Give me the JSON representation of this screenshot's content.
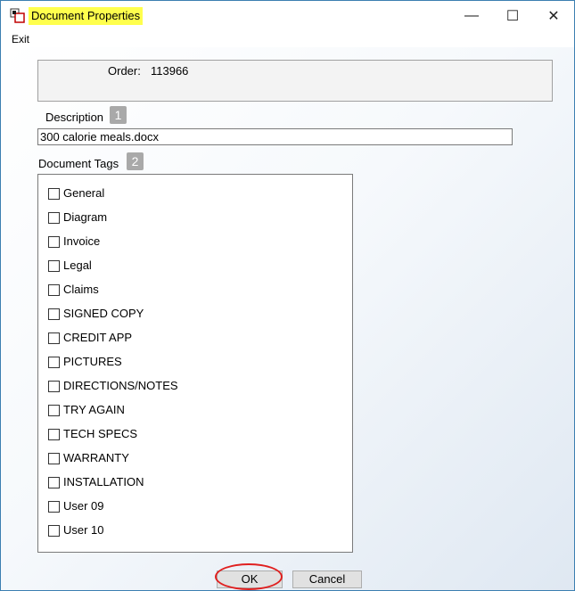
{
  "window": {
    "title": "Document Properties",
    "minimize_glyph": "—",
    "maximize_glyph": "☐",
    "close_glyph": "✕",
    "title_highlight_color": "#ffff4d"
  },
  "menu": {
    "exit_label": "Exit"
  },
  "order": {
    "label": "Order:",
    "value": "113966"
  },
  "description": {
    "label": "Description",
    "badge": "1",
    "value": "300 calorie meals.docx"
  },
  "tags": {
    "label": "Document Tags",
    "badge": "2",
    "items": [
      {
        "label": "General",
        "checked": false
      },
      {
        "label": "Diagram",
        "checked": false
      },
      {
        "label": "Invoice",
        "checked": false
      },
      {
        "label": "Legal",
        "checked": false
      },
      {
        "label": "Claims",
        "checked": false
      },
      {
        "label": "SIGNED COPY",
        "checked": false
      },
      {
        "label": "CREDIT APP",
        "checked": false
      },
      {
        "label": "PICTURES",
        "checked": false
      },
      {
        "label": "DIRECTIONS/NOTES",
        "checked": false
      },
      {
        "label": "TRY AGAIN",
        "checked": false
      },
      {
        "label": "TECH SPECS",
        "checked": false
      },
      {
        "label": "WARRANTY",
        "checked": false
      },
      {
        "label": "INSTALLATION",
        "checked": false
      },
      {
        "label": "User 09",
        "checked": false
      },
      {
        "label": "User 10",
        "checked": false
      }
    ]
  },
  "buttons": {
    "ok_label": "OK",
    "cancel_label": "Cancel"
  },
  "colors": {
    "annotation_circle": "#e02020",
    "badge_bg": "#a9a9a9"
  }
}
